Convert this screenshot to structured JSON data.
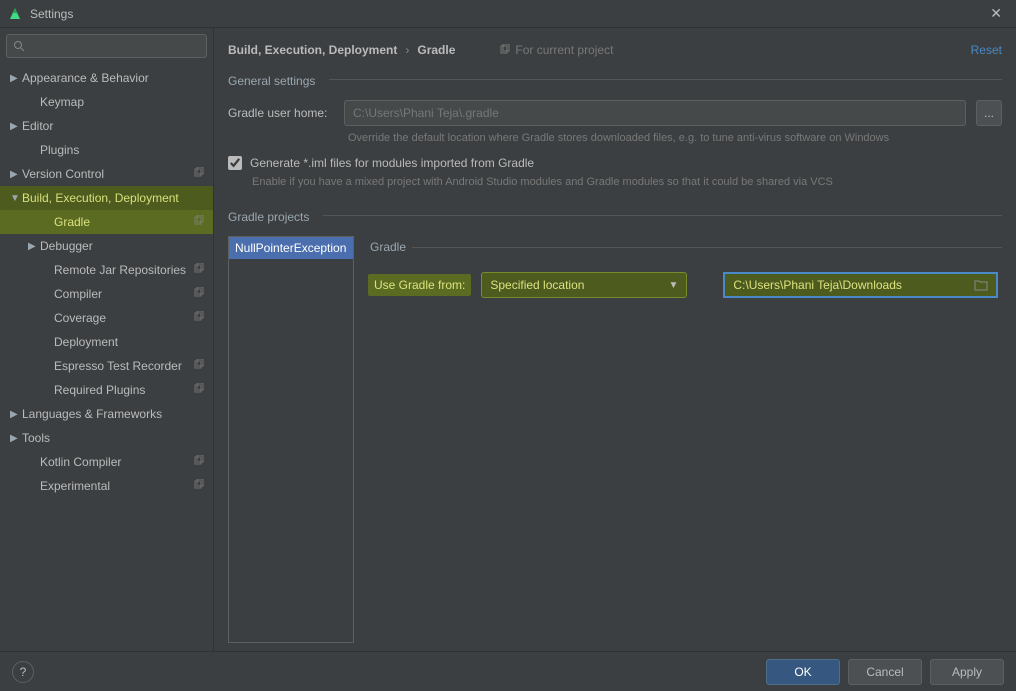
{
  "window": {
    "title": "Settings"
  },
  "search": {
    "placeholder": ""
  },
  "sidebar": {
    "items": [
      {
        "label": "Appearance & Behavior",
        "arrow": true,
        "indent": 1
      },
      {
        "label": "Keymap",
        "arrow": false,
        "indent": 2
      },
      {
        "label": "Editor",
        "arrow": true,
        "indent": 1
      },
      {
        "label": "Plugins",
        "arrow": false,
        "indent": 2
      },
      {
        "label": "Version Control",
        "arrow": true,
        "indent": 1,
        "copy": true
      },
      {
        "label": "Build, Execution, Deployment",
        "arrow": true,
        "indent": 1,
        "hlParent": true,
        "expanded": true
      },
      {
        "label": "Gradle",
        "arrow": false,
        "indent": 3,
        "selected": true,
        "copy": true,
        "hlChild": true
      },
      {
        "label": "Debugger",
        "arrow": true,
        "indent": 2
      },
      {
        "label": "Remote Jar Repositories",
        "arrow": false,
        "indent": 3,
        "copy": true
      },
      {
        "label": "Compiler",
        "arrow": false,
        "indent": 3,
        "copy": true
      },
      {
        "label": "Coverage",
        "arrow": false,
        "indent": 3,
        "copy": true
      },
      {
        "label": "Deployment",
        "arrow": false,
        "indent": 3
      },
      {
        "label": "Espresso Test Recorder",
        "arrow": false,
        "indent": 3,
        "copy": true
      },
      {
        "label": "Required Plugins",
        "arrow": false,
        "indent": 3,
        "copy": true
      },
      {
        "label": "Languages & Frameworks",
        "arrow": true,
        "indent": 1
      },
      {
        "label": "Tools",
        "arrow": true,
        "indent": 1
      },
      {
        "label": "Kotlin Compiler",
        "arrow": false,
        "indent": 2,
        "copy": true
      },
      {
        "label": "Experimental",
        "arrow": false,
        "indent": 2,
        "copy": true
      }
    ]
  },
  "breadcrumb": {
    "root": "Build, Execution, Deployment",
    "leaf": "Gradle"
  },
  "scope_label": "For current project",
  "reset_label": "Reset",
  "sections": {
    "general": "General settings",
    "projects": "Gradle projects",
    "gradle_detail": "Gradle"
  },
  "form": {
    "user_home_label": "Gradle user home:",
    "user_home_placeholder": "C:\\Users\\Phani Teja\\.gradle",
    "user_home_hint": "Override the default location where Gradle stores downloaded files, e.g. to tune anti-virus software on Windows",
    "generate_iml_label": "Generate *.iml files for modules imported from Gradle",
    "generate_iml_hint": "Enable if you have a mixed project with Android Studio modules and Gradle modules so that it could be shared via VCS",
    "use_gradle_from_label": "Use Gradle from:",
    "use_gradle_from_value": "Specified location",
    "gradle_path_value": "C:\\Users\\Phani Teja\\Downloads"
  },
  "projects_list": [
    {
      "name": "NullPointerException"
    }
  ],
  "buttons": {
    "ok": "OK",
    "cancel": "Cancel",
    "apply": "Apply",
    "browse": "..."
  }
}
